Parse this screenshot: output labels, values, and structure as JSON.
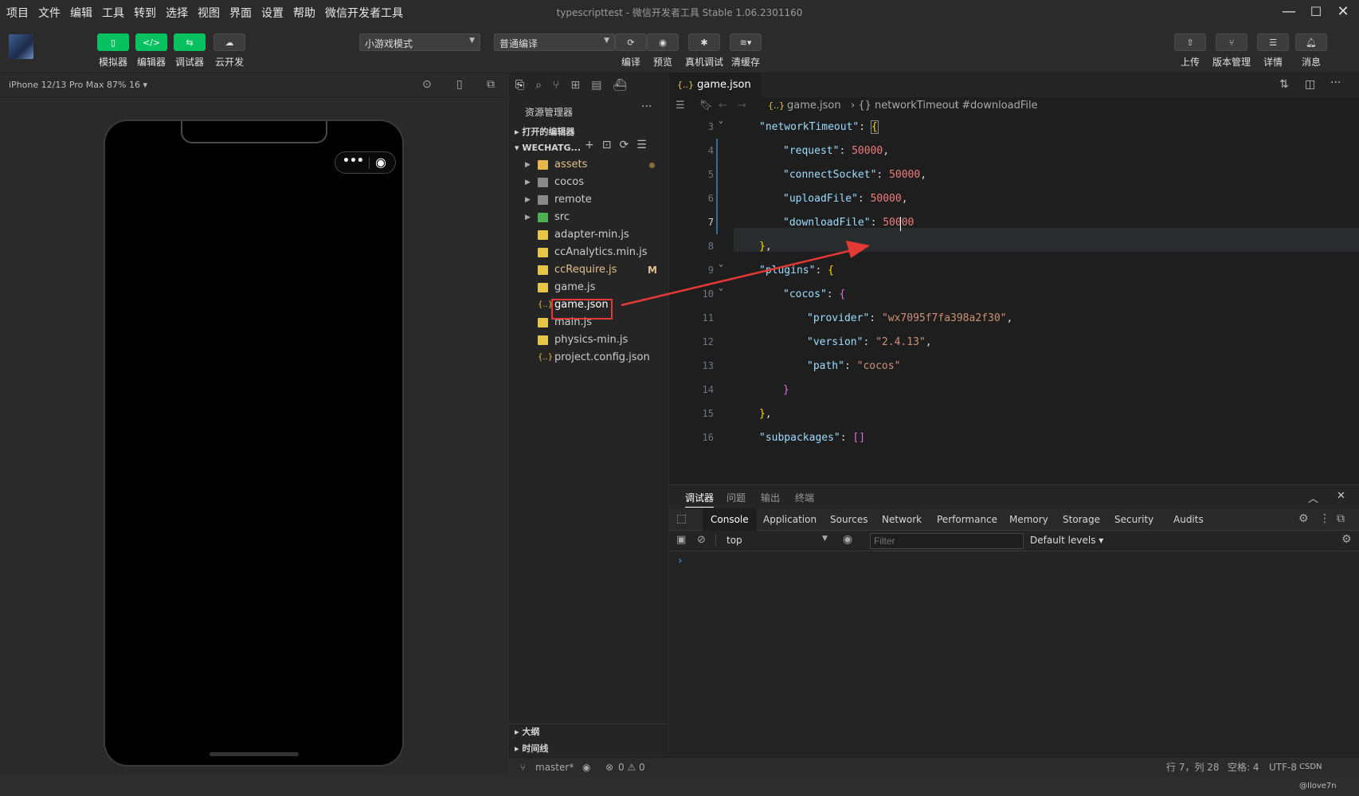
{
  "menubar": {
    "items": [
      "项目",
      "文件",
      "编辑",
      "工具",
      "转到",
      "选择",
      "视图",
      "界面",
      "设置",
      "帮助",
      "微信开发者工具"
    ],
    "title": "typescripttest - 微信开发者工具 Stable 1.06.2301160"
  },
  "toolbar": {
    "simulator": "模拟器",
    "editor": "编辑器",
    "debugger": "调试器",
    "cloud": "云开发",
    "mode_select": "小游戏模式",
    "compile_select": "普通编译",
    "compile": "编译",
    "preview": "预览",
    "remote_debug": "真机调试",
    "clear_cache": "清缓存",
    "upload": "上传",
    "version": "版本管理",
    "details": "详情",
    "messages": "消息"
  },
  "simulator": {
    "device": "iPhone 12/13 Pro Max 87% 16 ▾"
  },
  "explorer": {
    "title": "资源管理器",
    "open_editors": "打开的编辑器",
    "project": "WECHATG...",
    "items": [
      {
        "name": "assets",
        "type": "folder"
      },
      {
        "name": "cocos",
        "type": "folder"
      },
      {
        "name": "remote",
        "type": "folder"
      },
      {
        "name": "src",
        "type": "folder"
      },
      {
        "name": "adapter-min.js",
        "type": "js"
      },
      {
        "name": "ccAnalytics.min.js",
        "type": "js"
      },
      {
        "name": "ccRequire.js",
        "type": "js",
        "badge": "M"
      },
      {
        "name": "game.js",
        "type": "js"
      },
      {
        "name": "game.json",
        "type": "json"
      },
      {
        "name": "main.js",
        "type": "js"
      },
      {
        "name": "physics-min.js",
        "type": "js"
      },
      {
        "name": "project.config.json",
        "type": "json"
      }
    ],
    "outline": "大纲",
    "timeline": "时间线"
  },
  "editor": {
    "tab": "game.json",
    "breadcrumb": [
      "game.json",
      "networkTimeout",
      "downloadFile"
    ],
    "line_numbers": [
      "3",
      "4",
      "5",
      "6",
      "7",
      "8",
      "9",
      "10",
      "11",
      "12",
      "13",
      "14",
      "15",
      "16"
    ]
  },
  "devtools": {
    "panel_tabs": [
      "调试器",
      "问题",
      "输出",
      "终端"
    ],
    "tabs": [
      "Console",
      "Application",
      "Sources",
      "Network",
      "Performance",
      "Memory",
      "Storage",
      "Security",
      "Audits"
    ],
    "context": "top",
    "filter_placeholder": "Filter",
    "levels": "Default levels ▾",
    "prompt": "›"
  },
  "statusbar": {
    "branch": "master*",
    "problems": "0 ⚠ 0",
    "position": "行 7，列 28",
    "spaces": "空格: 4",
    "encoding": "UTF-8",
    "watermark": "CSDN @Ilove7n"
  }
}
